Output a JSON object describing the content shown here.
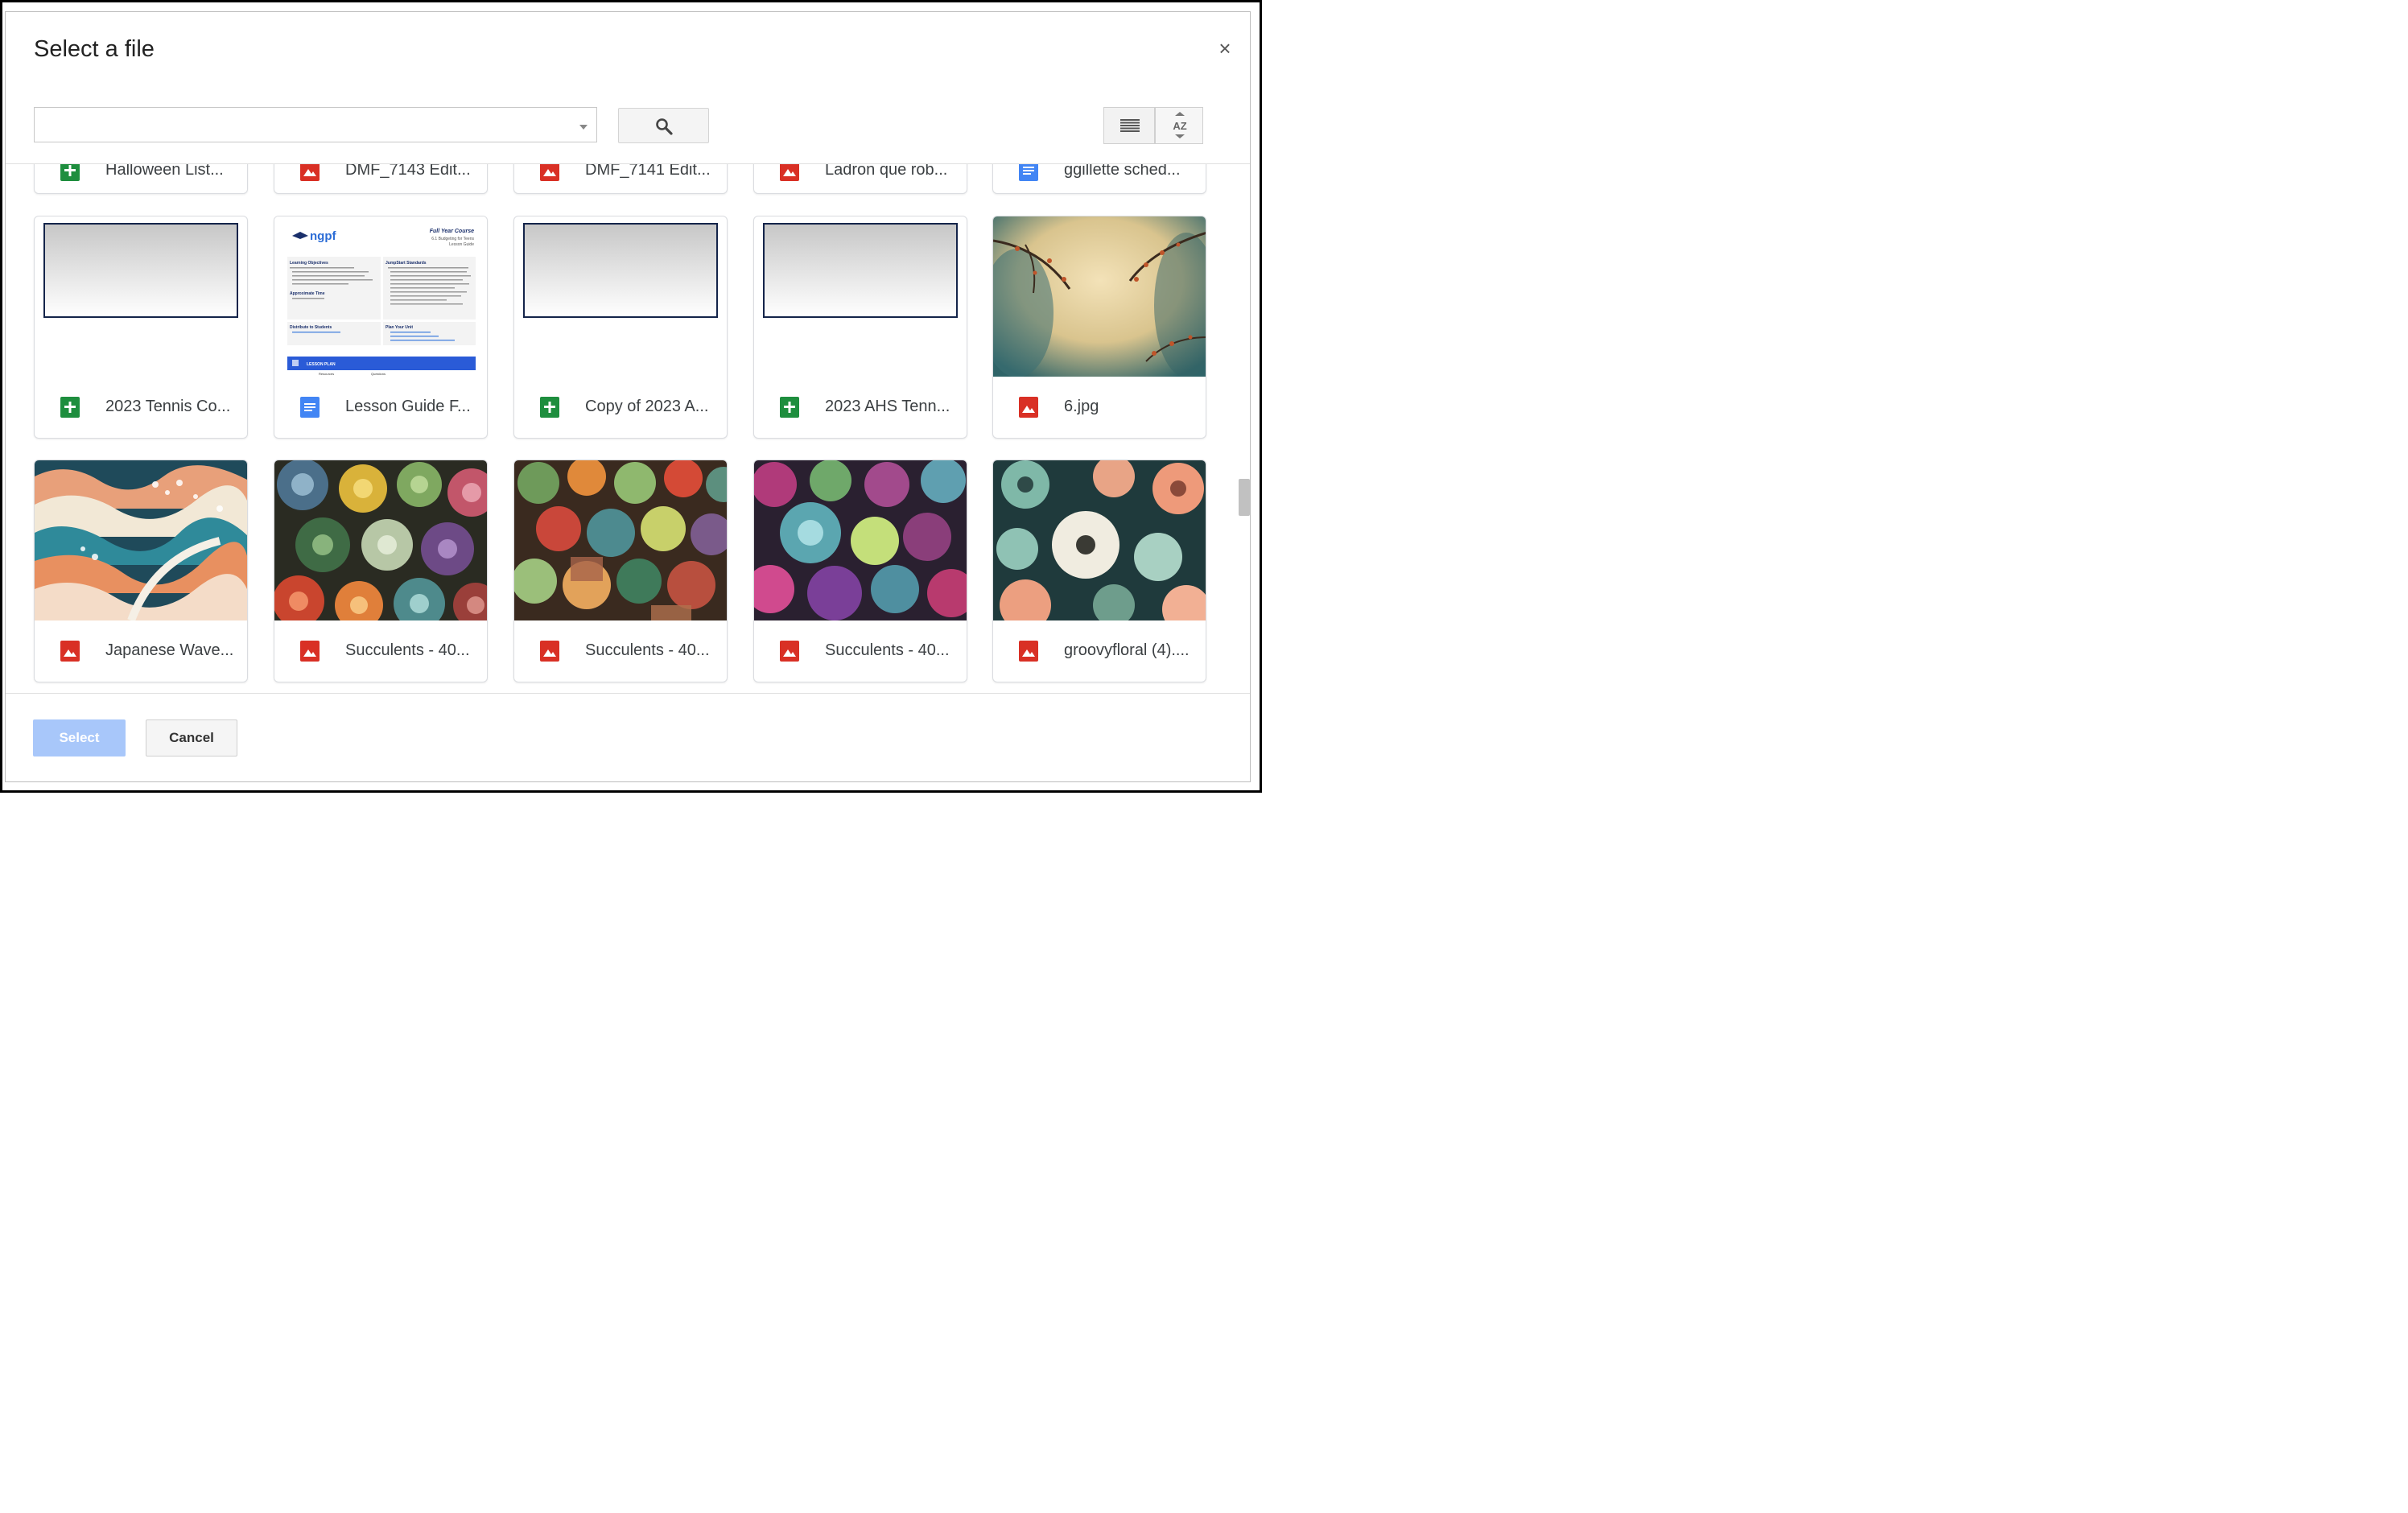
{
  "dialog": {
    "title": "Select a file",
    "close_symbol": "×",
    "search": {
      "value": "",
      "placeholder": ""
    },
    "search_button_icon": "search-icon",
    "view_toggle_icon": "list-view-icon",
    "sort_icon": "sort-az-icon",
    "sort_label": "AZ"
  },
  "partial_row": [
    {
      "name": "Halloween List...",
      "type": "sheets"
    },
    {
      "name": "DMF_7143 Edit...",
      "type": "image"
    },
    {
      "name": "DMF_7141 Edit...",
      "type": "image"
    },
    {
      "name": "Ladron que rob...",
      "type": "image"
    },
    {
      "name": "ggillette sched...",
      "type": "docs"
    }
  ],
  "row1": [
    {
      "name": "2023 Tennis Co...",
      "type": "sheets",
      "thumb": "placeholder"
    },
    {
      "name": "Lesson Guide F...",
      "type": "docs",
      "thumb": "lesson-guide"
    },
    {
      "name": "Copy of 2023 A...",
      "type": "sheets",
      "thumb": "placeholder"
    },
    {
      "name": "2023 AHS Tenn...",
      "type": "sheets",
      "thumb": "placeholder"
    },
    {
      "name": "6.jpg",
      "type": "image",
      "thumb": "watercolor"
    }
  ],
  "row2": [
    {
      "name": "Japanese Wave...",
      "type": "image",
      "thumb": "waves"
    },
    {
      "name": "Succulents - 40...",
      "type": "image",
      "thumb": "succulents-a"
    },
    {
      "name": "Succulents - 40...",
      "type": "image",
      "thumb": "succulents-b"
    },
    {
      "name": "Succulents - 40...",
      "type": "image",
      "thumb": "succulents-c"
    },
    {
      "name": "groovyfloral (4)....",
      "type": "image",
      "thumb": "floral"
    }
  ],
  "lesson_guide": {
    "logo": "ngpf",
    "heading": "Full Year Course",
    "subheading": "6.1 Budgeting for Teens",
    "subheading2": "Lesson Guide",
    "section1": "Learning Objectives",
    "section2": "JumpStart Standards",
    "section3": "Approximate Time",
    "section4": "Distribute to Students",
    "section5": "Plan Your Unit",
    "band": "LESSON PLAN",
    "col1": "Resources",
    "col2": "Questions"
  },
  "footer": {
    "select_label": "Select",
    "cancel_label": "Cancel"
  },
  "colors": {
    "sheets": "#1e8e3e",
    "docs": "#4285f4",
    "image": "#d93025",
    "select_disabled": "#a8c7fa"
  }
}
